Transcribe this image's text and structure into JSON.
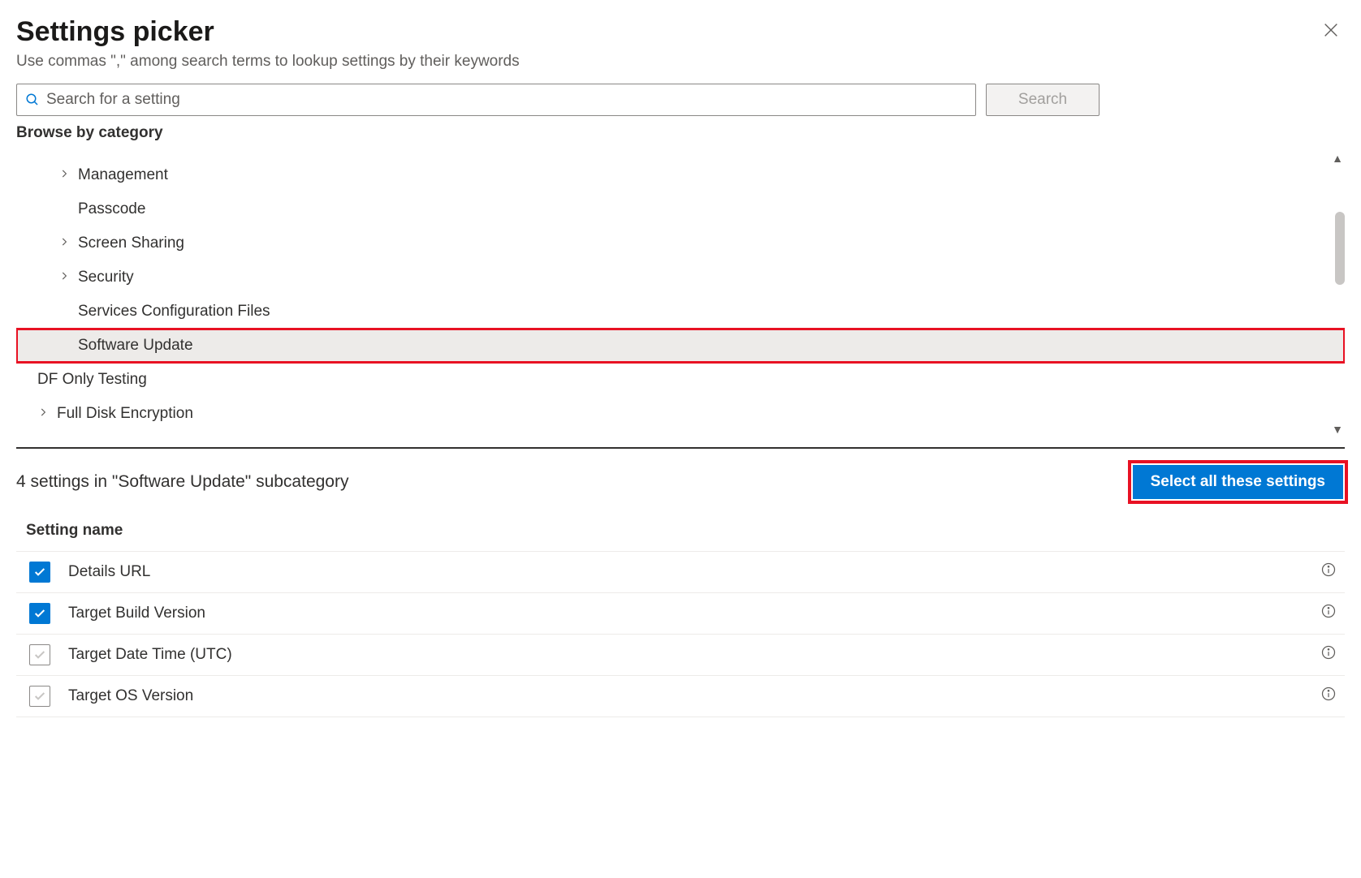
{
  "header": {
    "title": "Settings picker",
    "subtitle": "Use commas \",\" among search terms to lookup settings by their keywords"
  },
  "search": {
    "placeholder": "Search for a setting",
    "button_label": "Search"
  },
  "browse_label": "Browse by category",
  "categories": [
    {
      "label": "Management",
      "expandable": true,
      "level": 2,
      "selected": false
    },
    {
      "label": "Passcode",
      "expandable": false,
      "level": 2,
      "selected": false
    },
    {
      "label": "Screen Sharing",
      "expandable": true,
      "level": 2,
      "selected": false
    },
    {
      "label": "Security",
      "expandable": true,
      "level": 2,
      "selected": false
    },
    {
      "label": "Services Configuration Files",
      "expandable": false,
      "level": 2,
      "selected": false
    },
    {
      "label": "Software Update",
      "expandable": false,
      "level": 2,
      "selected": true,
      "highlighted": true
    },
    {
      "label": "DF Only Testing",
      "expandable": false,
      "level": 1,
      "selected": false
    },
    {
      "label": "Full Disk Encryption",
      "expandable": true,
      "level": 1,
      "selected": false
    }
  ],
  "subcategory": {
    "count_text": "4 settings in \"Software Update\" subcategory",
    "select_all_label": "Select all these settings",
    "column_header": "Setting name",
    "items": [
      {
        "label": "Details URL",
        "checked": true
      },
      {
        "label": "Target Build Version",
        "checked": true
      },
      {
        "label": "Target Date Time (UTC)",
        "checked": false
      },
      {
        "label": "Target OS Version",
        "checked": false
      }
    ]
  }
}
